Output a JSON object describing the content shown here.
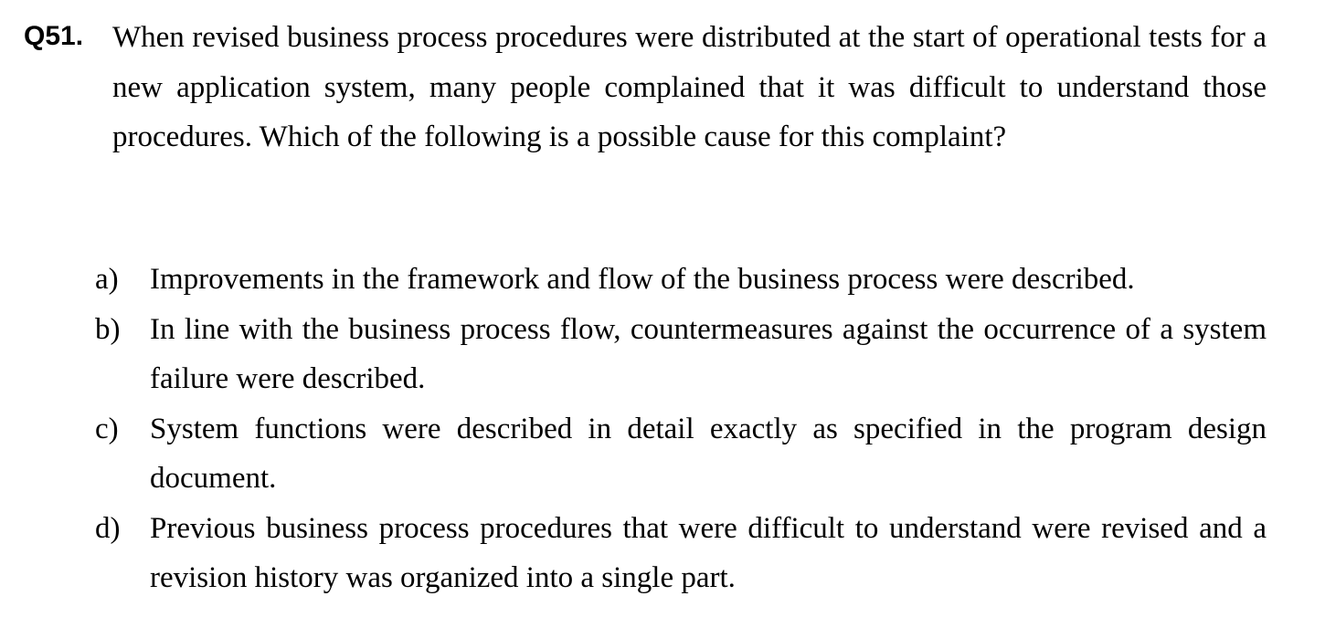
{
  "question": {
    "number": "Q51.",
    "text": "When revised business process procedures were distributed at the start of operational tests for a new application system, many people complained that it was difficult to understand those procedures.  Which of the following is a possible cause for this complaint?"
  },
  "choices": [
    {
      "marker": "a)",
      "text": "Improvements in the framework and flow of the business process were described."
    },
    {
      "marker": "b)",
      "text": "In line with the business process flow, countermeasures against the occurrence of a system failure were described."
    },
    {
      "marker": "c)",
      "text": "System functions were described in detail exactly as specified in the program design document."
    },
    {
      "marker": "d)",
      "text": "Previous business process procedures that were difficult to understand were revised and a revision history was organized into a single part."
    }
  ]
}
